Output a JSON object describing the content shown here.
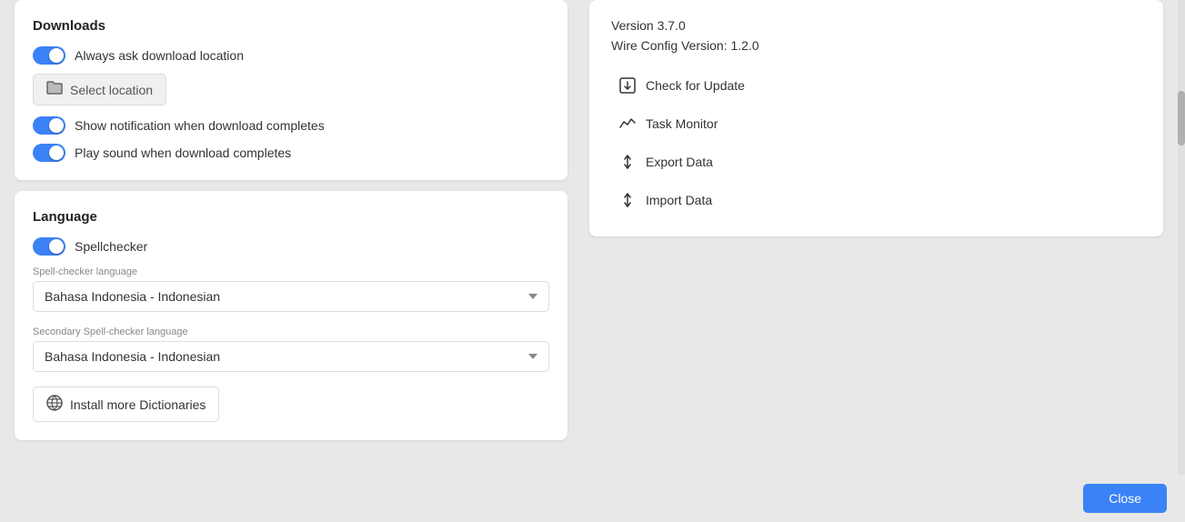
{
  "downloads": {
    "title": "Downloads",
    "always_ask_label": "Always ask download location",
    "always_ask_enabled": true,
    "select_location_label": "Select location",
    "show_notification_label": "Show notification when download completes",
    "show_notification_enabled": true,
    "play_sound_label": "Play sound when download completes",
    "play_sound_enabled": true
  },
  "language": {
    "title": "Language",
    "spellchecker_label": "Spellchecker",
    "spellchecker_enabled": true,
    "spell_checker_language_label": "Spell-checker language",
    "spell_checker_language_value": "Bahasa Indonesia - Indonesian",
    "secondary_language_label": "Secondary Spell-checker language",
    "secondary_language_value": "Bahasa Indonesia - Indonesian",
    "install_dictionaries_label": "Install more Dictionaries"
  },
  "info": {
    "version": "Version 3.7.0",
    "wire_config": "Wire Config Version: 1.2.0",
    "check_for_update": "Check for Update",
    "task_monitor": "Task Monitor",
    "export_data": "Export Data",
    "import_data": "Import Data"
  },
  "footer": {
    "close_label": "Close"
  },
  "icons": {
    "folder": "📁",
    "globe": "🌐",
    "update": "⬇",
    "monitor": "📈",
    "export": "↕",
    "import": "↕"
  }
}
